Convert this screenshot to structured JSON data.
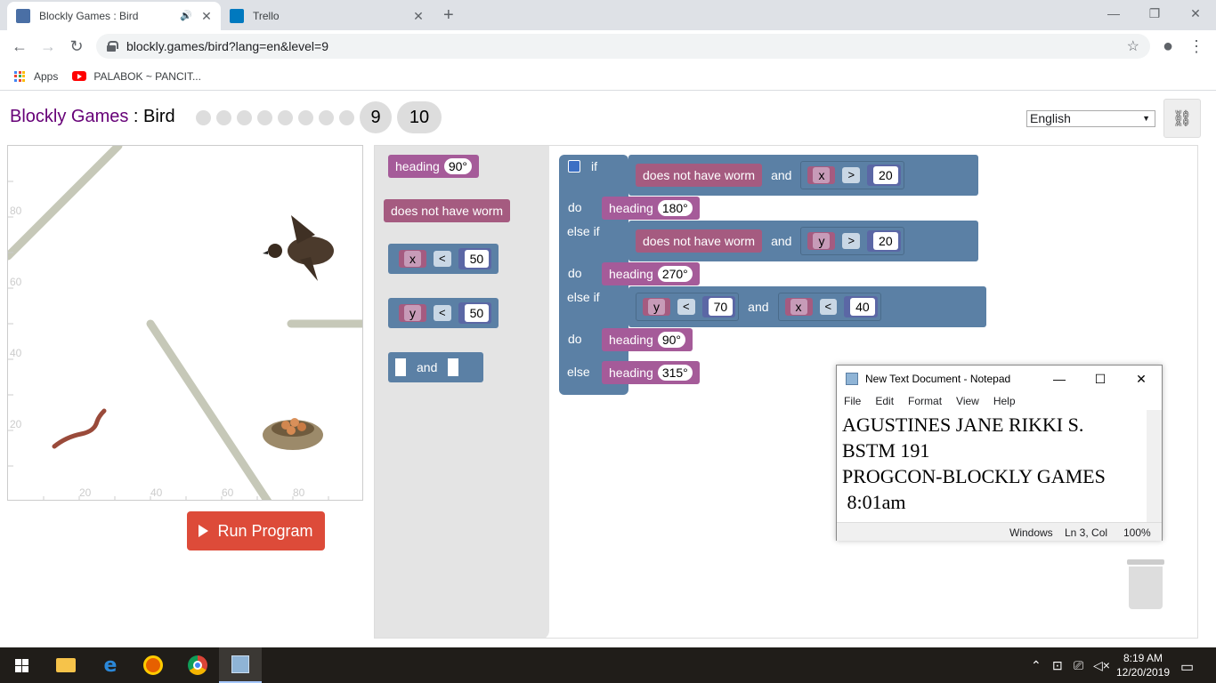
{
  "browser": {
    "tabs": [
      {
        "title": "Blockly Games : Bird",
        "active": true
      },
      {
        "title": "Trello",
        "active": false
      }
    ],
    "new_tab_label": "+",
    "url": "blockly.games/bird?lang=en&level=9",
    "bookmarks": [
      {
        "label": "Apps",
        "icon": "apps-grid-icon"
      },
      {
        "label": "PALABOK ~ PANCIT...",
        "icon": "youtube-icon"
      }
    ]
  },
  "page": {
    "title_app": "Blockly Games",
    "title_sep": " : ",
    "title_game": "Bird",
    "levels": [
      "1",
      "2",
      "3",
      "4",
      "5",
      "6",
      "7",
      "8",
      "9",
      "10"
    ],
    "current_level": "9",
    "next_level": "10",
    "language": "English",
    "run_button": "Run Program"
  },
  "visual": {
    "y_ticks": [
      "80",
      "60",
      "40",
      "20"
    ],
    "x_ticks": [
      "20",
      "40",
      "60",
      "80"
    ]
  },
  "toolbox": {
    "heading_label": "heading",
    "heading_value": "90°",
    "no_worm_label": "does not have worm",
    "x_var": "x",
    "y_var": "y",
    "lt": "<",
    "fifty": "50",
    "and_label": "and"
  },
  "program": {
    "if_label": "if",
    "do_label": "do",
    "else_if_label": "else if",
    "else_label": "else",
    "and_label": "and",
    "heading_label": "heading",
    "no_worm_label": "does not have worm",
    "cond1": {
      "var": "x",
      "op": ">",
      "val": "20"
    },
    "cond2": {
      "var": "y",
      "op": ">",
      "val": "20"
    },
    "cond3a": {
      "var": "y",
      "op": "<",
      "val": "70"
    },
    "cond3b": {
      "var": "x",
      "op": "<",
      "val": "40"
    },
    "heading1": "180°",
    "heading2": "270°",
    "heading3": "90°",
    "heading4": "315°"
  },
  "notepad": {
    "title": "New Text Document - Notepad",
    "menu": [
      "File",
      "Edit",
      "Format",
      "View",
      "Help"
    ],
    "lines": [
      "AGUSTINES JANE RIKKI S.",
      "BSTM 191",
      "PROGCON-BLOCKLY GAMES",
      " 8:01am"
    ],
    "status_windows": "Windows",
    "status_pos": "Ln 3, Col",
    "status_zoom": "100%"
  },
  "taskbar": {
    "time": "8:19 AM",
    "date": "12/20/2019"
  }
}
